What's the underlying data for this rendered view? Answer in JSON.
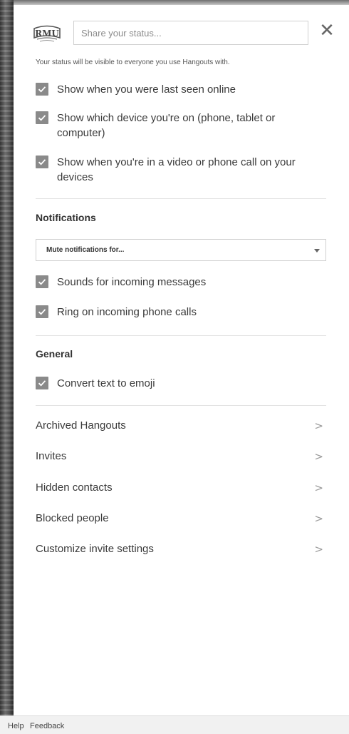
{
  "header": {
    "logo_text": "RMU",
    "status_placeholder": "Share your status...",
    "close_glyph": "✕",
    "status_hint": "Your status will be visible to everyone you use Hangouts with."
  },
  "presence": [
    {
      "label": "Show when you were last seen online",
      "checked": true
    },
    {
      "label": "Show which device you're on (phone, tablet or computer)",
      "checked": true
    },
    {
      "label": "Show when you're in a video or phone call on your devices",
      "checked": true
    }
  ],
  "notifications": {
    "heading": "Notifications",
    "mute_select": "Mute notifications for...",
    "items": [
      {
        "label": "Sounds for incoming messages",
        "checked": true
      },
      {
        "label": "Ring on incoming phone calls",
        "checked": true
      }
    ]
  },
  "general": {
    "heading": "General",
    "items": [
      {
        "label": "Convert text to emoji",
        "checked": true
      }
    ]
  },
  "nav": [
    {
      "label": "Archived Hangouts",
      "chevron": ">"
    },
    {
      "label": "Invites",
      "chevron": ">"
    },
    {
      "label": "Hidden contacts",
      "chevron": ">"
    },
    {
      "label": "Blocked people",
      "chevron": ">"
    },
    {
      "label": "Customize invite settings",
      "chevron": ">"
    }
  ],
  "footer": {
    "help": "Help",
    "feedback": "Feedback"
  },
  "colors": {
    "checkbox": "#8a8a8a",
    "divider": "#e2e2e2",
    "text": "#3a3a3a"
  },
  "icons": {
    "logo": "rmu-logo-icon",
    "close": "close-icon",
    "checkbox": "checkmark-icon",
    "dropdown": "caret-down-icon",
    "nav": "chevron-right-icon"
  }
}
